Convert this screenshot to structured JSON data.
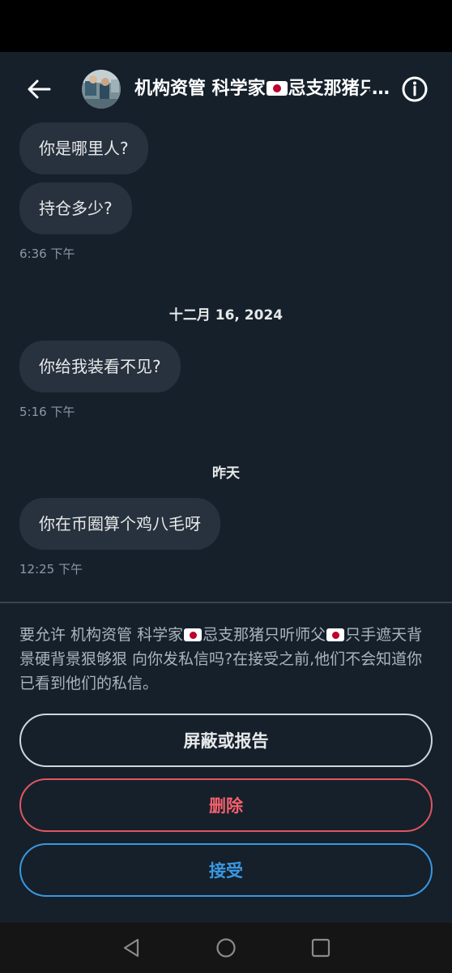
{
  "header": {
    "title_prefix": "机构资管 科学家",
    "title_suffix": "忌支那猪只听师父",
    "ellipsis": "…",
    "back_icon": "arrow-left-icon",
    "info_icon": "info-circle-icon"
  },
  "messages": [
    {
      "text": "你是哪里人?"
    },
    {
      "text": "持仓多少?"
    },
    {
      "time": "6:36 下午"
    },
    {
      "date": "十二月 16, 2024"
    },
    {
      "text": "你给我装看不见?"
    },
    {
      "time": "5:16 下午"
    },
    {
      "date": "昨天"
    },
    {
      "text": "你在币圈算个鸡八毛呀"
    },
    {
      "time": "12:25 下午"
    }
  ],
  "request": {
    "text_part1": "要允许 机构资管 科学家",
    "text_part2": "忌支那猪只听师父",
    "text_part3": "只手遮天背景硬背景狠够狠 向你发私信吗?在接受之前,他们不会知道你已看到他们的私信。",
    "block_label": "屏蔽或报告",
    "delete_label": "删除",
    "accept_label": "接受"
  },
  "colors": {
    "background": "#15202b",
    "bubble": "#28323e",
    "delete": "#f4606c",
    "accept": "#3a97e0"
  },
  "navbar": {
    "back_icon": "nav-back-triangle-icon",
    "home_icon": "nav-home-circle-icon",
    "recents_icon": "nav-recents-square-icon"
  }
}
